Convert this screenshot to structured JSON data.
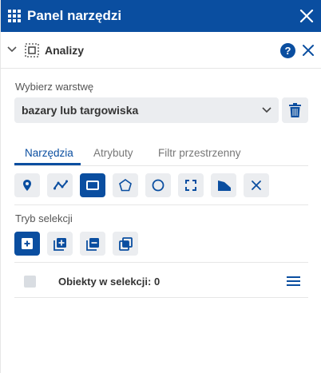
{
  "header": {
    "title": "Panel narzędzi",
    "close_icon": "close-icon",
    "menu_icon": "grid-icon"
  },
  "section": {
    "title": "Analizy",
    "help_label": "?",
    "collapse_icon": "chevron-down-icon",
    "icon": "dotted-square-icon"
  },
  "layer": {
    "label": "Wybierz warstwę",
    "selected": "bazary lub targowiska",
    "delete_icon": "trash-icon"
  },
  "tabs": [
    {
      "label": "Narzędzia",
      "active": true
    },
    {
      "label": "Atrybuty",
      "active": false
    },
    {
      "label": "Filtr przestrzenny",
      "active": false
    }
  ],
  "tools": [
    {
      "icon": "point-marker-icon",
      "active": false
    },
    {
      "icon": "polyline-icon",
      "active": false
    },
    {
      "icon": "rectangle-icon",
      "active": true
    },
    {
      "icon": "polygon-icon",
      "active": false
    },
    {
      "icon": "circle-icon",
      "active": false
    },
    {
      "icon": "extent-icon",
      "active": false
    },
    {
      "icon": "freehand-icon",
      "active": false
    },
    {
      "icon": "clear-icon",
      "active": false
    }
  ],
  "selection": {
    "label": "Tryb selekcji",
    "modes": [
      {
        "icon": "new-selection-icon",
        "active": true
      },
      {
        "icon": "add-to-selection-icon",
        "active": false
      },
      {
        "icon": "remove-from-selection-icon",
        "active": false
      },
      {
        "icon": "intersect-selection-icon",
        "active": false
      }
    ]
  },
  "objects": {
    "label": "Obiekty w selekcji: 0",
    "menu_icon": "hamburger-menu-icon"
  },
  "colors": {
    "primary": "#0a4ea0",
    "button_bg": "#ebedf0"
  }
}
